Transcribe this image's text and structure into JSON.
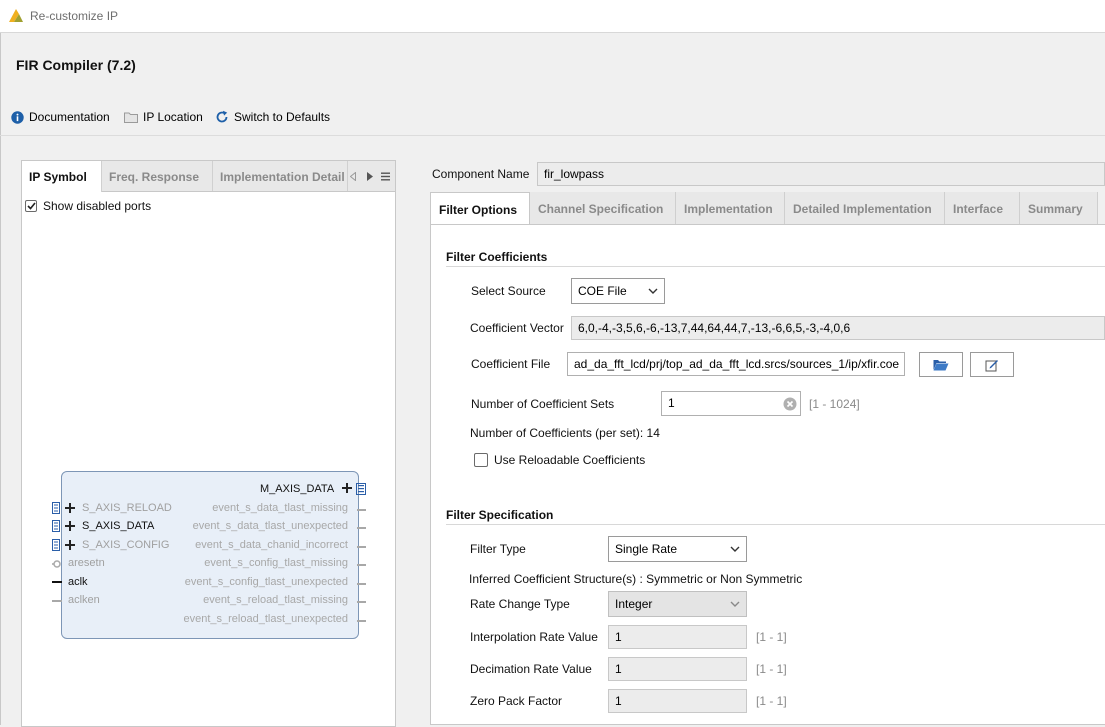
{
  "window": {
    "title": "Re-customize IP"
  },
  "ip": {
    "title": "FIR Compiler (7.2)"
  },
  "toolbar": {
    "documentation": "Documentation",
    "ip_location": "IP Location",
    "switch_defaults": "Switch to Defaults"
  },
  "left": {
    "tabs": [
      "IP Symbol",
      "Freq. Response",
      "Implementation Detail"
    ],
    "show_disabled_ports": "Show disabled ports",
    "show_disabled_checked": true
  },
  "symbol": {
    "output_port": "M_AXIS_DATA",
    "left_ports": [
      {
        "name": "S_AXIS_RELOAD",
        "enabled": false
      },
      {
        "name": "S_AXIS_DATA",
        "enabled": true
      },
      {
        "name": "S_AXIS_CONFIG",
        "enabled": false
      },
      {
        "name": "aresetn",
        "enabled": false
      },
      {
        "name": "aclk",
        "enabled": true
      },
      {
        "name": "aclken",
        "enabled": false
      }
    ],
    "right_ports": [
      "event_s_data_tlast_missing",
      "event_s_data_tlast_unexpected",
      "event_s_data_chanid_incorrect",
      "event_s_config_tlast_missing",
      "event_s_config_tlast_unexpected",
      "event_s_reload_tlast_missing",
      "event_s_reload_tlast_unexpected"
    ]
  },
  "component": {
    "label": "Component Name",
    "value": "fir_lowpass"
  },
  "tabs": [
    "Filter Options",
    "Channel Specification",
    "Implementation",
    "Detailed Implementation",
    "Interface",
    "Summary"
  ],
  "filter_coefficients": {
    "section": "Filter Coefficients",
    "select_source_label": "Select Source",
    "select_source_value": "COE File",
    "coeff_vector_label": "Coefficient Vector",
    "coeff_vector_value": "6,0,-4,-3,5,6,-6,-13,7,44,64,44,7,-13,-6,6,5,-3,-4,0,6",
    "coeff_file_label": "Coefficient File",
    "coeff_file_value": "ad_da_fft_lcd/prj/top_ad_da_fft_lcd.srcs/sources_1/ip/xfir.coe",
    "num_sets_label": "Number of Coefficient Sets",
    "num_sets_value": "1",
    "num_sets_range": "[1 - 1024]",
    "num_coeffs_text": "Number of Coefficients (per set): 14",
    "reloadable_label": "Use Reloadable Coefficients",
    "reloadable_checked": false
  },
  "filter_spec": {
    "section": "Filter Specification",
    "filter_type_label": "Filter Type",
    "filter_type_value": "Single Rate",
    "inferred_text": "Inferred Coefficient Structure(s) : Symmetric or Non Symmetric",
    "rate_change_label": "Rate Change Type",
    "rate_change_value": "Integer",
    "interp_label": "Interpolation Rate Value",
    "interp_value": "1",
    "interp_range": "[1 - 1]",
    "decim_label": "Decimation Rate Value",
    "decim_value": "1",
    "decim_range": "[1 - 1]",
    "zero_pack_label": "Zero Pack Factor",
    "zero_pack_value": "1",
    "zero_pack_range": "[1 - 1]"
  },
  "colors": {
    "accent": "#1d5fa8",
    "symbol_fill": "#e8eff8",
    "symbol_border": "#7d96b6"
  }
}
